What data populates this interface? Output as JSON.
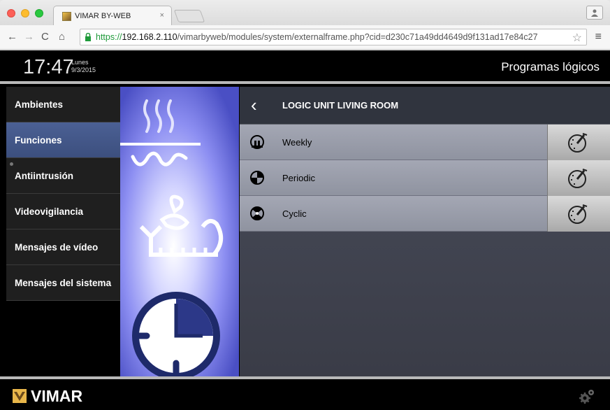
{
  "browser": {
    "tab_title": "VIMAR BY-WEB",
    "tab_close": "×",
    "url_scheme": "https://",
    "url_host": "192.168.2.110",
    "url_path": "/vimarbyweb/modules/system/externalframe.php?cid=d230c71a49dd4649d9f131ad17e84c27"
  },
  "header": {
    "time": "17:47",
    "day": "Lunes",
    "date": "9/3/2015",
    "title": "Programas lógicos"
  },
  "sidebar": {
    "items": [
      {
        "label": "Ambientes",
        "active": false
      },
      {
        "label": "Funciones",
        "active": true
      },
      {
        "label": "Antiintrusión",
        "active": false
      },
      {
        "label": "Videovigilancia",
        "active": false
      },
      {
        "label": "Mensajes de vídeo",
        "active": false
      },
      {
        "label": "Mensajes del sistema",
        "active": false
      }
    ]
  },
  "main": {
    "title": "LOGIC UNIT LIVING ROOM",
    "rows": [
      {
        "label": "Weekly",
        "icon": "weekly-icon"
      },
      {
        "label": "Periodic",
        "icon": "periodic-icon"
      },
      {
        "label": "Cyclic",
        "icon": "cyclic-icon"
      }
    ]
  },
  "footer": {
    "brand": "VIMAR"
  },
  "colors": {
    "accent": "#4b6094",
    "row_bg": "#9a9eab",
    "header_bg": "#30343e"
  }
}
